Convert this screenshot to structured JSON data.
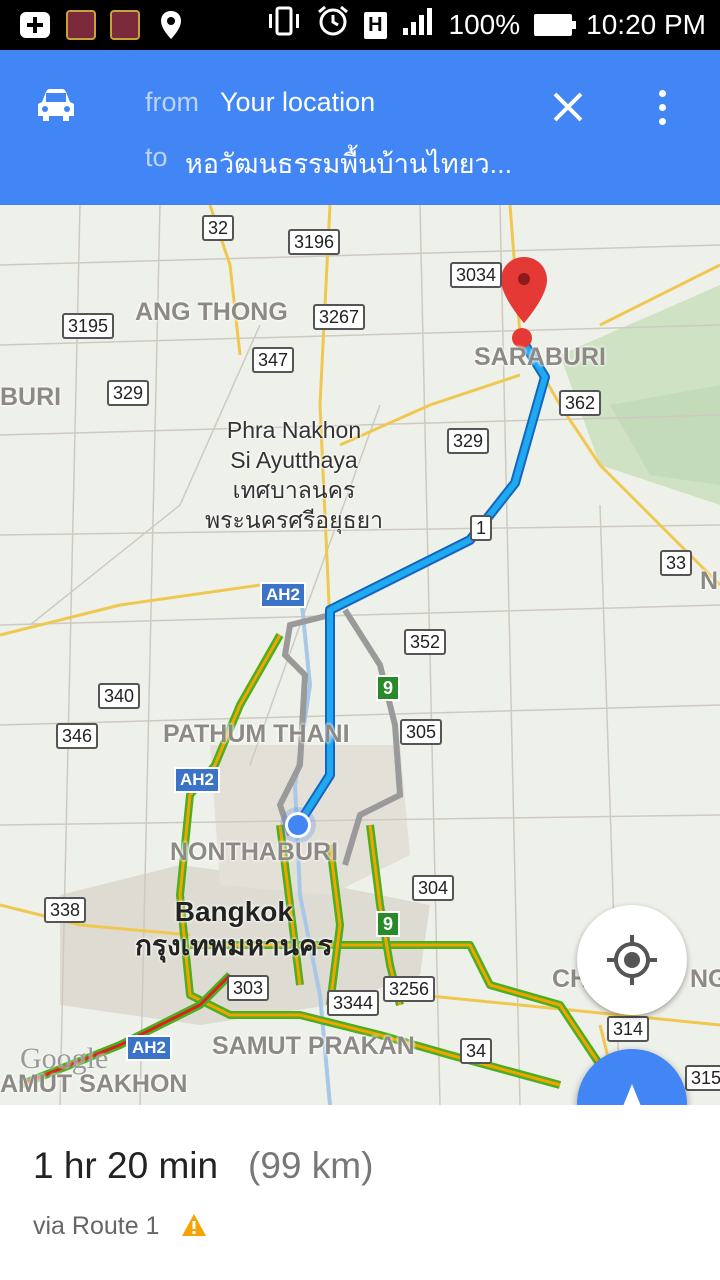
{
  "status_bar": {
    "battery": "100%",
    "time": "10:20 PM",
    "network_badge": "H",
    "icons": [
      "add-icon",
      "app-icon",
      "app-icon",
      "location-icon",
      "vibrate-icon",
      "alarm-icon",
      "signal-icon",
      "battery-icon"
    ]
  },
  "directions": {
    "mode_icon": "car-icon",
    "from_label": "from",
    "from_value": "Your location",
    "to_label": "to",
    "to_value": "หอวัฒนธรรมพื้นบ้านไทยว..."
  },
  "map": {
    "places": {
      "ang_thong": "ANG THONG",
      "buri": "BURI",
      "saraburi": "SARABURI",
      "pathum_thani": "PATHUM THANI",
      "nonthaburi": "NONTHABURI",
      "samut_prakan": "SAMUT PRAKAN",
      "samut_sakhon": "AMUT SAKHON",
      "ch": "CH",
      "ng": "NG",
      "n": "N"
    },
    "ayutthaya": [
      "Phra Nakhon",
      "Si Ayutthaya",
      "เทศบาลนคร",
      "พระนครศรีอยุธยา"
    ],
    "bangkok": [
      "Bangkok",
      "กรุงเทพมหานคร"
    ],
    "route_shields": [
      "32",
      "3196",
      "3034",
      "3195",
      "3267",
      "347",
      "329",
      "362",
      "329",
      "1",
      "33",
      "352",
      "340",
      "346",
      "305",
      "304",
      "338",
      "303",
      "3344",
      "3256",
      "314",
      "34",
      "315"
    ],
    "ah_shields": [
      "AH2",
      "AH2",
      "AH2"
    ],
    "green_shields": [
      "9",
      "9"
    ],
    "attribution": "Google"
  },
  "summary": {
    "duration": "1 hr 20 min",
    "distance": "(99 km)",
    "via": "via Route 1"
  },
  "colors": {
    "appbar": "#4285f4",
    "route": "#1fa9f0",
    "traffic_green": "#4caf1f",
    "traffic_orange": "#f4a300",
    "warning": "#f4a300"
  }
}
